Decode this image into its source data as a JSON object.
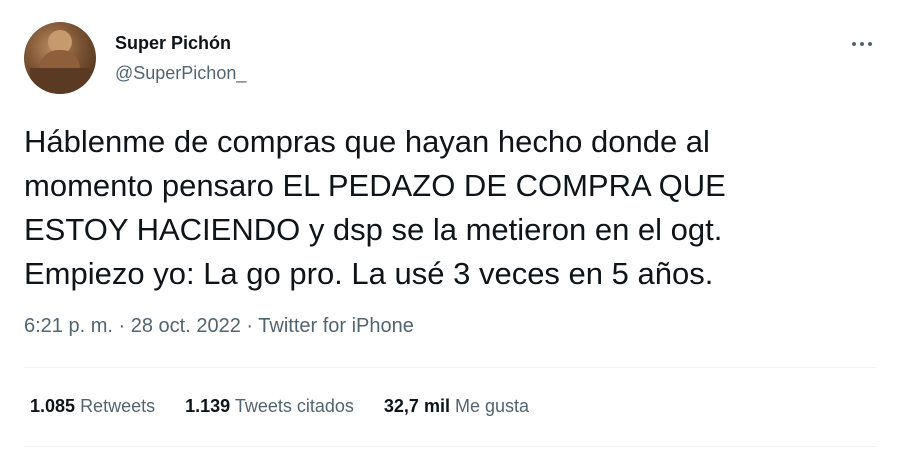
{
  "author": {
    "display_name": "Super Pichón",
    "handle": "@SuperPichon_"
  },
  "tweet": {
    "lines": [
      "Háblenme de compras que hayan hecho donde al",
      "momento pensaro EL PEDAZO DE COMPRA QUE",
      "ESTOY HACIENDO y dsp se la metieron en el ogt.",
      "Empiezo yo: La go pro. La usé 3 veces en 5 años."
    ],
    "time": "6:21 p. m.",
    "separator": "·",
    "date": "28 oct. 2022",
    "source": "Twitter for iPhone"
  },
  "stats": {
    "retweets_count": "1.085",
    "retweets_label": "Retweets",
    "quotes_count": "1.139",
    "quotes_label": "Tweets citados",
    "likes_count": "32,7 mil",
    "likes_label": "Me gusta"
  },
  "icons": {
    "more": "more-horizontal-icon"
  },
  "colors": {
    "text_primary": "#0f1419",
    "text_secondary": "#536471",
    "divider": "#eff3f4"
  }
}
